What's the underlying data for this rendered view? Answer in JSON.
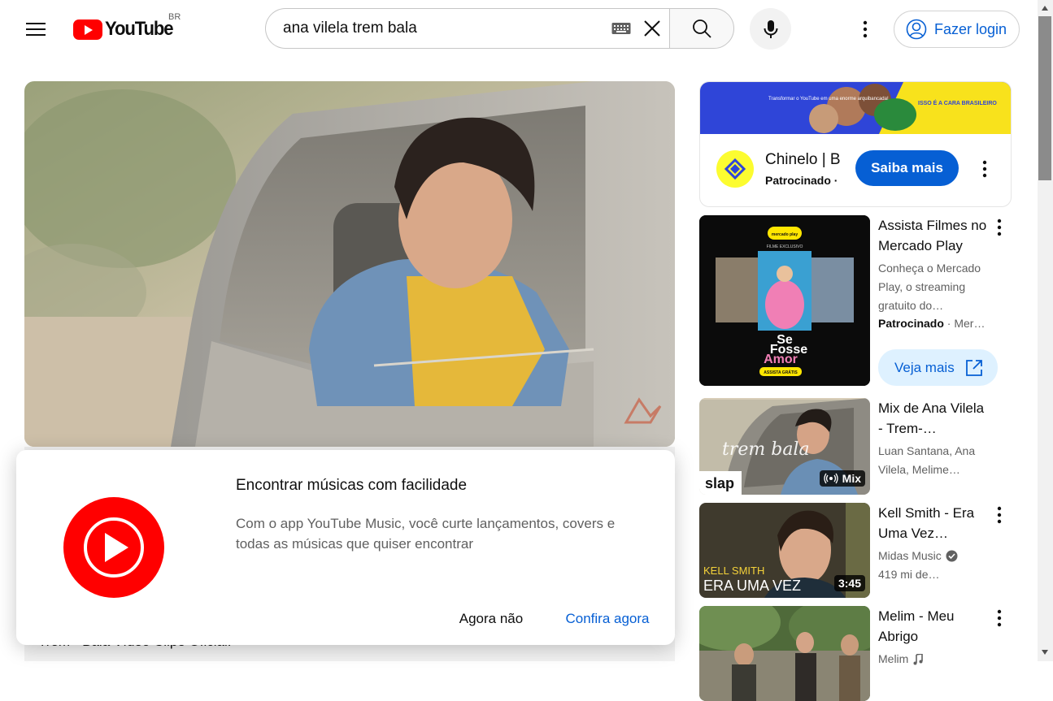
{
  "header": {
    "logo_text": "YouTube",
    "region": "BR",
    "search_value": "ana vilela trem bala",
    "login_label": "Fazer login"
  },
  "player": {
    "title_peek": "Trem - Bala Vídeo Clipe Oficial."
  },
  "music_dialog": {
    "title": "Encontrar músicas com facilidade",
    "body": "Com o app YouTube Music, você curte lançamentos, covers e todas as músicas que quiser encontrar",
    "dismiss_label": "Agora não",
    "confirm_label": "Confira agora"
  },
  "ad_card": {
    "banner_text_left": "Transformar o YouTube em uma enorme arquibancada!",
    "banner_text_right": "ISSO É A CARA BRASILEIRO",
    "advertiser": "Chinelo | B",
    "sponsored": "Patrocinado ·",
    "cta": "Saiba mais"
  },
  "recommendations": [
    {
      "title": "Assista Filmes no Mercado Play",
      "meta": "Conheça o Mercado Play, o streaming gratuito do…",
      "sponsored": "Patrocinado",
      "sponsored_extra": "· Mer…",
      "cta": "Veja mais",
      "thumb_brand": "mercado play",
      "thumb_tag": "FILME EXCLUSIVO",
      "thumb_title_1": "Se",
      "thumb_title_2": "Fosse",
      "thumb_title_3": "Amor",
      "thumb_button": "ASSISTA GRÁTIS"
    },
    {
      "title": "Mix de Ana Vilela - Trem-…",
      "meta": "Luan Santana, Ana Vilela, Melime…",
      "badge": "Mix",
      "thumb_script": "trem bala",
      "thumb_label": "slap"
    },
    {
      "title": "Kell Smith - Era Uma Vez…",
      "channel": "Midas Music",
      "meta": "419 mi de…",
      "duration": "3:45",
      "thumb_line1": "KELL SMITH",
      "thumb_line2": "ERA UMA VEZ"
    },
    {
      "title": "Melim - Meu Abrigo",
      "channel": "Melim"
    }
  ],
  "colors": {
    "accent": "#065fd4",
    "brand_red": "#ff0000",
    "text_primary": "#0f0f0f",
    "text_secondary": "#606060"
  }
}
